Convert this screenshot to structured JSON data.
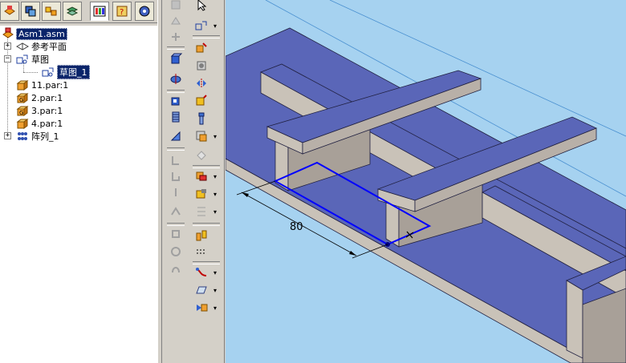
{
  "tree": {
    "items": [
      {
        "label": "Asm1.asm",
        "icon": "assembly-icon"
      },
      {
        "label": "参考平面",
        "icon": "reference-planes-icon"
      },
      {
        "label": "草图",
        "icon": "sketch-icon"
      },
      {
        "label": "草图_1",
        "icon": "sketch-icon"
      },
      {
        "label": "11.par:1",
        "icon": "part-icon"
      },
      {
        "label": "2.par:1",
        "icon": "part-icon"
      },
      {
        "label": "3.par:1",
        "icon": "part-icon"
      },
      {
        "label": "4.par:1",
        "icon": "part-icon"
      },
      {
        "label": "阵列_1",
        "icon": "pattern-icon"
      }
    ]
  },
  "viewport": {
    "dimension_value": "80",
    "colors": {
      "background": "#a6d2f0",
      "top_face": "#5a66b8",
      "side_face": "#c9c2b8",
      "sketch_line": "#0000ff"
    }
  },
  "colors": {
    "selection": "#0a246a",
    "panel": "#d4d0c8"
  }
}
